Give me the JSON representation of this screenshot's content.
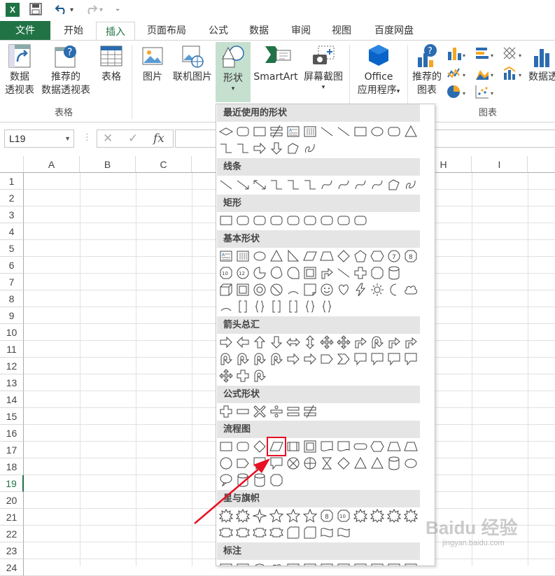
{
  "qat": {
    "app_icon": "X",
    "save": "save-icon",
    "undo": "undo-icon",
    "redo": "redo-icon"
  },
  "tabs": [
    {
      "label": "文件"
    },
    {
      "label": "开始"
    },
    {
      "label": "插入"
    },
    {
      "label": "页面布局"
    },
    {
      "label": "公式"
    },
    {
      "label": "数据"
    },
    {
      "label": "审阅"
    },
    {
      "label": "视图"
    },
    {
      "label": "百度网盘"
    }
  ],
  "ribbon": {
    "pivot": "数据\n透视表",
    "pivot_l1": "数据",
    "pivot_l2": "透视表",
    "recpivot_l1": "推荐的",
    "recpivot_l2": "数据透视表",
    "table": "表格",
    "group_tables": "表格",
    "picture": "图片",
    "online_picture": "联机图片",
    "shapes": "形状",
    "smartart": "SmartArt",
    "screenshot": "屏幕截图",
    "office_l1": "Office",
    "office_l2": "应用程序",
    "recchart_l1": "推荐的",
    "recchart_l2": "图表",
    "pivotchart": "数据透",
    "group_charts": "图表"
  },
  "formula_bar": {
    "namebox": "L19",
    "fx": "fx"
  },
  "columns": [
    "A",
    "B",
    "C",
    "H",
    "I"
  ],
  "rows": [
    "1",
    "2",
    "3",
    "4",
    "5",
    "6",
    "7",
    "8",
    "9",
    "10",
    "11",
    "12",
    "13",
    "14",
    "15",
    "16",
    "17",
    "18",
    "19",
    "20",
    "21",
    "22",
    "23",
    "24"
  ],
  "shapes_menu": {
    "sections": [
      "最近使用的形状",
      "线条",
      "矩形",
      "基本形状",
      "箭头总汇",
      "公式形状",
      "流程图",
      "星与旗帜",
      "标注"
    ]
  },
  "watermark": {
    "text": "Baidu 经验",
    "sub": "jingyan.baidu.com"
  },
  "colors": {
    "accent": "#217346",
    "highlight": "#e81123"
  }
}
